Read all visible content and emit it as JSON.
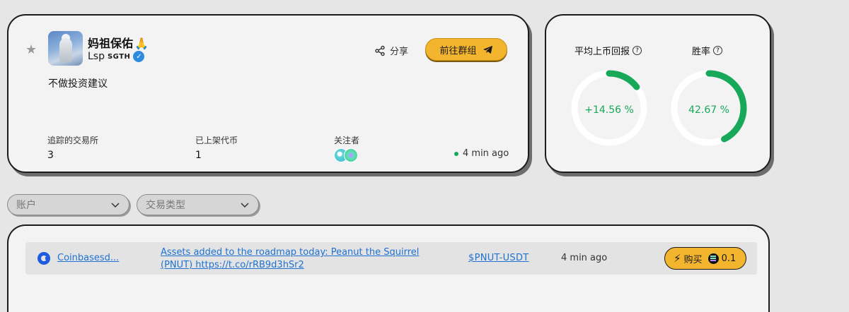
{
  "profile": {
    "name": "妈祖保佑",
    "name_emoji": "🙏",
    "handle": "Lsp",
    "handle_tag": "SGTH",
    "bio": "不做投资建议",
    "share_label": "分享",
    "group_button_label": "前往群组",
    "stats": [
      {
        "label": "追踪的交易所",
        "value": "3"
      },
      {
        "label": "已上架代币",
        "value": "1"
      },
      {
        "label": "关注者"
      }
    ],
    "last_active": "4 min ago"
  },
  "metrics": {
    "avg_return": {
      "label": "平均上币回报",
      "value": "+14.56 %",
      "fraction": 0.1456
    },
    "win_rate": {
      "label": "胜率",
      "value": "42.67 %",
      "fraction": 0.4267
    }
  },
  "filters": {
    "account_placeholder": "账户",
    "trade_type_placeholder": "交易类型"
  },
  "feed": [
    {
      "exchange": "Coinbasesd...",
      "post": "Assets added to the roadmap today: Peanut the Squirrel (PNUT) https://t.co/rRB9d3hSr2",
      "pair": "$PNUT-USDT",
      "time": "4 min ago",
      "buy_label": "购买",
      "amount": "0.1"
    }
  ],
  "colors": {
    "accent": "#f4b52e",
    "positive": "#17a85a",
    "link": "#1f72d1"
  }
}
